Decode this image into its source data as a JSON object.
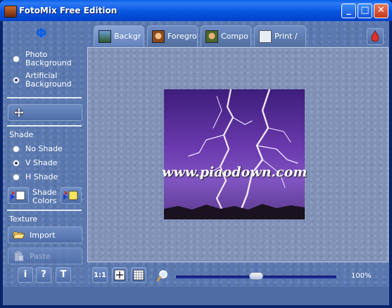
{
  "window": {
    "title": "FotoMix Free Edition",
    "minimize": "_",
    "maximize": "□",
    "close": "✕"
  },
  "sidebar": {
    "logo": "Φ",
    "background_options": [
      {
        "label_line1": "Photo",
        "label_line2": "Background",
        "selected": false
      },
      {
        "label_line1": "Artificial",
        "label_line2": "Background",
        "selected": true
      }
    ],
    "shade_label": "Shade",
    "shade_options": [
      {
        "label": "No Shade",
        "selected": false
      },
      {
        "label": "V Shade",
        "selected": true
      },
      {
        "label": "H Shade",
        "selected": false
      }
    ],
    "shade_colors_line1": "Shade",
    "shade_colors_line2": "Colors",
    "texture_label": "Texture",
    "import_label": "Import",
    "paste_label": "Paste",
    "info_label": "i",
    "help_label": "?",
    "text_label": "T"
  },
  "tabs": [
    {
      "label": "Backgr",
      "active": true
    },
    {
      "label": "Foregro",
      "active": false
    },
    {
      "label": "Compo",
      "active": false
    },
    {
      "label": "Print /",
      "active": false
    }
  ],
  "canvas": {
    "watermark": "www.piaodown.com"
  },
  "bottom": {
    "actual_size_label": "1:1",
    "zoom_percent": "100%",
    "zoom_value": 0.5
  },
  "colors": {
    "accent": "#0a5fe6",
    "panel": "#5b79b0"
  }
}
